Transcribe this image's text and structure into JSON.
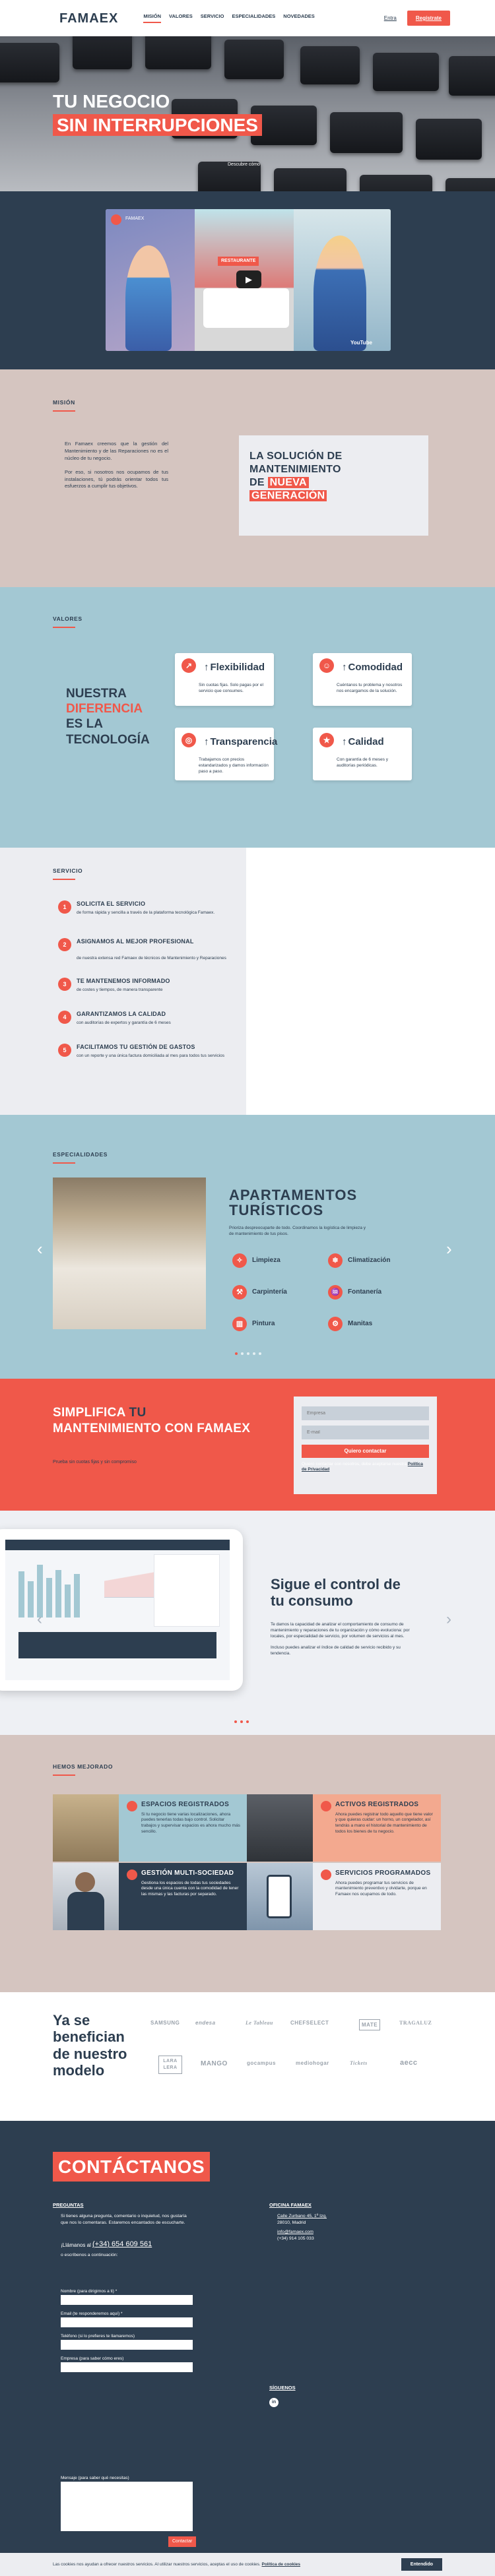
{
  "header": {
    "logo_text": "FAMAEX",
    "nav": [
      "MISIÓN",
      "VALORES",
      "SERVICIO",
      "ESPECIALIDADES",
      "NOVEDADES"
    ],
    "login": "Entra",
    "register": "Regístrate"
  },
  "hero": {
    "line1": "TU NEGOCIO",
    "line2": "SIN INTERRUPCIONES",
    "photo_credit": "Descubre cómo"
  },
  "video": {
    "title": "FAMAEX",
    "sign": "RESTAURANTE",
    "youtube": "YouTube"
  },
  "mision": {
    "label": "MISIÓN",
    "p1": "En Famaex creemos que la gestión del Mantenimiento y de las Reparaciones no es el núcleo de tu negocio.",
    "p2": "Por eso, si nosotros nos ocupamos de tus instalaciones, tú podrás orientar todos tus esfuerzos a cumplir tus objetivos.",
    "box_l1": "LA SOLUCIÓN DE",
    "box_l2": "MANTENIMIENTO",
    "box_l3a": "DE ",
    "box_l3b": "NUEVA",
    "box_l4": "GENERACIÓN"
  },
  "valores": {
    "label": "VALORES",
    "big1": "NUESTRA",
    "big2": "DIFERENCIA",
    "big3": "ES LA",
    "big4": "TECNOLOGÍA",
    "cards": [
      {
        "title": "Flexibilidad",
        "text": "Sin cuotas fijas. Solo pagas por el servicio que consumes."
      },
      {
        "title": "Comodidad",
        "text": "Cuéntanos tu problema y nosotros nos encargamos de la solución."
      },
      {
        "title": "Transparencia",
        "text": "Trabajamos con precios estandarizados y damos información paso a paso."
      },
      {
        "title": "Calidad",
        "text": "Con garantía de 6 meses y auditorías periódicas."
      }
    ]
  },
  "servicio": {
    "label": "SERVICIO",
    "steps": [
      {
        "n": "1",
        "title": "SOLICITA EL SERVICIO",
        "text": "de forma rápida y sencilla a través de la plataforma tecnológica Famaex."
      },
      {
        "n": "2",
        "title": "ASIGNAMOS AL MEJOR PROFESIONAL",
        "text": "de nuestra extensa red Famaex de técnicos de Mantenimiento y Reparaciones"
      },
      {
        "n": "3",
        "title": "TE MANTENEMOS INFORMADO",
        "text": "de costes y tiempos, de manera transparente"
      },
      {
        "n": "4",
        "title": "GARANTIZAMOS LA CALIDAD",
        "text": "con auditorías de expertos y garantía de 6 meses"
      },
      {
        "n": "5",
        "title": "FACILITAMOS TU GESTIÓN DE GASTOS",
        "text": "con un reporte y una única factura domiciliada al mes para todos tus servicios"
      }
    ]
  },
  "especialidades": {
    "label": "ESPECIALIDADES",
    "title1": "APARTAMENTOS",
    "title2": "TURÍSTICOS",
    "desc": "Prioriza despreocuparte de todo. Coordinamos la logística de limpieza y de mantenimiento de tus pisos.",
    "items": [
      "Limpieza",
      "Climatización",
      "Carpintería",
      "Fontanería",
      "Pintura",
      "Manitas"
    ]
  },
  "simplifica": {
    "t1a": "SIMPLIFICA ",
    "t1b": "TU",
    "t2": "MANTENIMIENTO CON FAMAEX",
    "sub": "Prueba sin cuotas fijas y sin compromiso",
    "ph_empresa": "Empresa",
    "ph_email": "E-mail",
    "button": "Quiero contactar",
    "legal": "Quiero contactar con nosotros, debe aceptarse nuestra",
    "legal_link": "Política de Privacidad"
  },
  "control": {
    "t1": "Sigue el control de",
    "t2": "tu consumo",
    "p1": "Te damos la capacidad de analizar el comportamiento de consumo de mantenimiento y reparaciones de tu organización y cómo evoluciona: por locales, por especialidad de servicio, por volumen de servicios al mes.",
    "p2": "Incluso puedes analizar el índice de calidad de servicio recibido y su tendencia."
  },
  "mejorado": {
    "label": "HEMOS MEJORADO",
    "tiles": [
      {
        "title": "ESPACIOS REGISTRADOS",
        "text": "Si tu negocio tiene varias localizaciones, ahora puedes tenerlas todas bajo control. Solicitar trabajos y supervisar espacios es ahora mucho más sencillo."
      },
      {
        "title": "ACTIVOS REGISTRADOS",
        "text": "Ahora puedes registrar todo aquello que tiene valor y que quieras cuidar: un horno, un congelador, así tendrás a mano el historial de mantenimiento de todos los bienes de tu negocio."
      },
      {
        "title": "GESTIÓN MULTI-SOCIEDAD",
        "text": "Gestiona los espacios de todas tus sociedades desde una única cuenta con la comodidad de tener las mismas y las facturas por separado."
      },
      {
        "title": "SERVICIOS PROGRAMADOS",
        "text": "Ahora puedes programar tus servicios de mantenimiento preventivo y olvidarte, porque en Famaex nos ocupamos de todo."
      }
    ]
  },
  "clientes": {
    "t1": "Ya se",
    "t2": "benefician",
    "t3": "de nuestro",
    "t4": "modelo",
    "logos": [
      "SAMSUNG",
      "endesa",
      "Le Tableau",
      "CHEFSELECT",
      "MATE",
      "TRAGALUZ",
      "LARA LERA",
      "MANGO",
      "gocampus",
      "mediohogar",
      "Tickets",
      "aecc"
    ]
  },
  "contacto": {
    "title": "CONTÁCTANOS",
    "preguntas": "PREGUNTAS",
    "q_text": "Si tienes alguna pregunta, comentario o inquietud, nos gustaría que nos lo comentaras. Estaremos encantados de escucharte.",
    "call": "¡Llámanos al",
    "phone": "(+34) 654 609 561",
    "or_form": "o escríbenos a continuación:",
    "f_nombre": "Nombre (para dirigirnos a ti) *",
    "f_email": "Email (te responderemos aquí) *",
    "f_tel": "Teléfono (si lo prefieres te llamaremos)",
    "f_empresa": "Empresa (para saber cómo eres)",
    "f_msg": "Mensaje (para saber qué necesitas)",
    "submit": "Contactar",
    "oficina": "OFICINA FAMAEX",
    "addr1": "Calle Zurbano 45, 1º Izq.",
    "addr2": "28010, Madrid",
    "mail": "info@famaex.com",
    "tel": "(+34) 914 105 033",
    "siguenos": "SÍGUENOS",
    "linkedin": "in"
  },
  "cookie": {
    "text": "Las cookies nos ayudan a ofrecer nuestros servicios. Al utilizar nuestros servicios, aceptas el uso de cookies.",
    "link": "Política de cookies",
    "accept": "Entendido"
  }
}
